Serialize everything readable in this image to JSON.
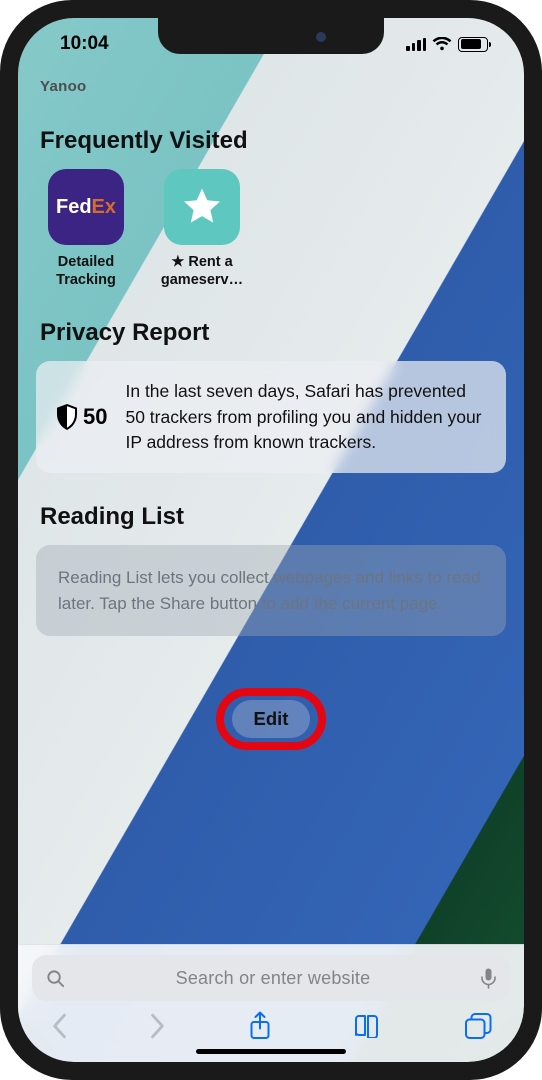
{
  "status": {
    "time": "10:04"
  },
  "truncated_site": "Yanoo",
  "sections": {
    "frequently_visited": {
      "title": "Frequently Visited",
      "items": [
        {
          "label": "Detailed Tracking",
          "icon": "fedex"
        },
        {
          "label": "★ Rent a gameserv…",
          "icon": "star"
        }
      ]
    },
    "privacy_report": {
      "title": "Privacy Report",
      "tracker_count": "50",
      "description": "In the last seven days, Safari has prevented 50 trackers from profiling you and hidden your IP address from known trackers."
    },
    "reading_list": {
      "title": "Reading List",
      "description": "Reading List lets you collect webpages and links to read later. Tap the Share button to add the current page."
    }
  },
  "edit_button": "Edit",
  "url_bar": {
    "placeholder": "Search or enter website"
  }
}
